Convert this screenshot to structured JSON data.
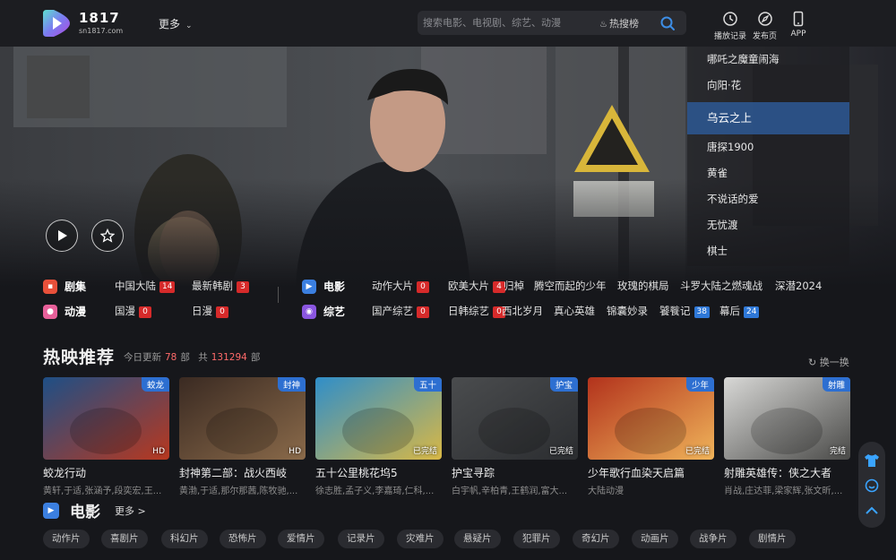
{
  "header": {
    "logo_name": "1817",
    "logo_url": "sn1817.com",
    "more": "更多",
    "search_placeholder": "搜索电影、电视剧、综艺、动漫",
    "hot_link": "热搜榜",
    "tools": [
      {
        "label": "播放记录",
        "icon": "clock-icon"
      },
      {
        "label": "发布页",
        "icon": "compass-icon"
      },
      {
        "label": "APP",
        "icon": "phone-icon"
      }
    ]
  },
  "hero": {
    "list": [
      "哪吒之魔童闹海",
      "向阳·花",
      "乌云之上",
      "唐探1900",
      "黄雀",
      "不说话的爱",
      "无忧渡",
      "棋士"
    ],
    "active_index": 2
  },
  "categories": {
    "tv": {
      "label": "剧集",
      "links": [
        {
          "name": "中国大陆",
          "count": "14"
        },
        {
          "name": "最新韩剧",
          "count": "3"
        }
      ]
    },
    "anime": {
      "label": "动漫",
      "links": [
        {
          "name": "国漫",
          "count": "0"
        },
        {
          "name": "日漫",
          "count": "0"
        }
      ]
    },
    "movie": {
      "label": "电影",
      "links": [
        {
          "name": "动作大片",
          "count": "0"
        },
        {
          "name": "欧美大片",
          "count": "4"
        }
      ]
    },
    "variety": {
      "label": "综艺",
      "links": [
        {
          "name": "国产综艺",
          "count": "0"
        },
        {
          "name": "日韩综艺",
          "count": "0"
        }
      ]
    },
    "hot_row1": [
      "归棹",
      "腾空而起的少年",
      "玫瑰的棋局",
      "斗罗大陆之燃魂战",
      "深潜2024"
    ],
    "hot_row2": [
      {
        "name": "西北岁月"
      },
      {
        "name": "真心英雄"
      },
      {
        "name": "锦囊妙录"
      },
      {
        "name": "饕餮记",
        "count": "38"
      },
      {
        "name": "幕后",
        "count": "24"
      }
    ]
  },
  "recommend": {
    "title": "热映推荐",
    "today_label": "今日更新",
    "today_count": "78",
    "unit1": "部",
    "total_label": "共",
    "total_count": "131294",
    "unit2": "部",
    "refresh": "换一换",
    "cards": [
      {
        "title": "蛟龙行动",
        "cast": "黄轩,于适,张涵予,段奕宏,王...",
        "tag": "蛟龙",
        "corner": "HD",
        "bg1": "#1e4f86",
        "bg2": "#b8381f"
      },
      {
        "title": "封神第二部：战火西岐",
        "cast": "黄渤,于适,那尔那茜,陈牧驰,...",
        "tag": "封神",
        "corner": "HD",
        "bg1": "#3a2a22",
        "bg2": "#8a6a4a"
      },
      {
        "title": "五十公里桃花坞5",
        "cast": "徐志胜,孟子义,李嘉琦,仁科,...",
        "tag": "五十",
        "corner": "已完结",
        "bg1": "#2f8ec9",
        "bg2": "#d9b845"
      },
      {
        "title": "护宝寻踪",
        "cast": "白宇帆,辛柏青,王鹤润,富大...",
        "tag": "护宝",
        "corner": "已完结",
        "bg1": "#4a4c4e",
        "bg2": "#2b2d30"
      },
      {
        "title": "少年歌行血染天启篇",
        "cast": "大陆动漫",
        "tag": "少年",
        "corner": "已完结",
        "bg1": "#b2321c",
        "bg2": "#f0b45a"
      },
      {
        "title": "射雕英雄传：侠之大者",
        "cast": "肖战,庄达菲,梁家辉,张文昕,...",
        "tag": "射雕",
        "corner": "完结",
        "bg1": "#d8d8d6",
        "bg2": "#4a4a48"
      }
    ]
  },
  "movie_section": {
    "title": "电影",
    "more": "更多 >"
  },
  "genres": [
    "动作片",
    "喜剧片",
    "科幻片",
    "恐怖片",
    "爱情片",
    "记录片",
    "灾难片",
    "悬疑片",
    "犯罪片",
    "奇幻片",
    "动画片",
    "战争片",
    "剧情片"
  ],
  "colors": {
    "accent": "#2e78d8",
    "badge_red": "#d62a2a",
    "active_item": "#2d558c"
  }
}
